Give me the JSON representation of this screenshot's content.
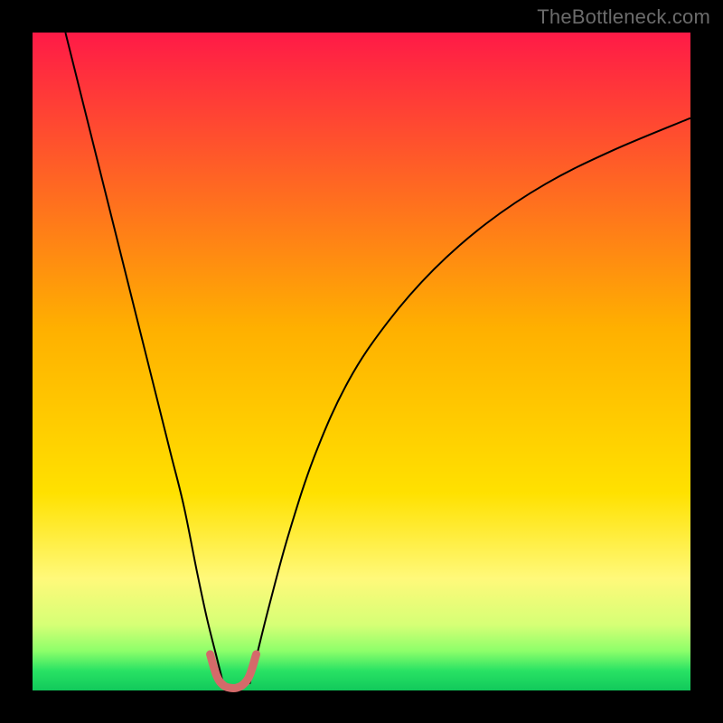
{
  "watermark": "TheBottleneck.com",
  "chart_data": {
    "type": "line",
    "title": "",
    "xlabel": "",
    "ylabel": "",
    "xlim": [
      0,
      100
    ],
    "ylim": [
      0,
      100
    ],
    "gradient_stops": [
      {
        "offset": 0.0,
        "color": "#ff1a47"
      },
      {
        "offset": 0.45,
        "color": "#ffb000"
      },
      {
        "offset": 0.7,
        "color": "#ffe100"
      },
      {
        "offset": 0.83,
        "color": "#fff97a"
      },
      {
        "offset": 0.9,
        "color": "#d6ff76"
      },
      {
        "offset": 0.94,
        "color": "#8dff6a"
      },
      {
        "offset": 0.97,
        "color": "#29e264"
      },
      {
        "offset": 1.0,
        "color": "#11c95b"
      }
    ],
    "series": [
      {
        "name": "left-branch",
        "x": [
          5,
          7,
          9,
          11,
          13,
          15,
          17,
          19,
          21,
          23,
          25,
          26.5,
          28,
          29
        ],
        "y": [
          100,
          92,
          84,
          76,
          68,
          60,
          52,
          44,
          36,
          28,
          18,
          11,
          5,
          1
        ],
        "stroke": "#000000",
        "width": 2
      },
      {
        "name": "right-branch",
        "x": [
          33,
          34,
          36,
          39,
          43,
          48,
          54,
          61,
          69,
          78,
          88,
          100
        ],
        "y": [
          1,
          5,
          13,
          24,
          36,
          47,
          56,
          64,
          71,
          77,
          82,
          87
        ],
        "stroke": "#000000",
        "width": 2
      },
      {
        "name": "valley-highlight",
        "x": [
          27,
          28,
          29,
          30,
          31,
          32,
          33,
          34
        ],
        "y": [
          5.5,
          2.2,
          0.8,
          0.4,
          0.4,
          0.9,
          2.3,
          5.5
        ],
        "stroke": "#d46a6a",
        "width": 9,
        "linecap": "round"
      }
    ]
  }
}
